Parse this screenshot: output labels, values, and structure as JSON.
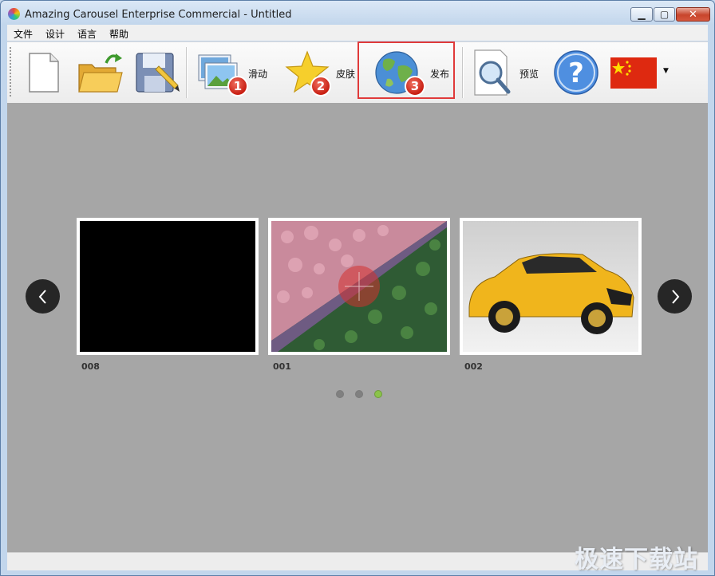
{
  "window": {
    "title": "Amazing Carousel Enterprise Commercial - Untitled"
  },
  "menu": [
    "文件",
    "设计",
    "语言",
    "帮助"
  ],
  "toolbar": {
    "slides_label": "滑动",
    "skin_label": "皮肤",
    "publish_label": "发布",
    "preview_label": "预览",
    "step_badges": [
      "1",
      "2",
      "3"
    ]
  },
  "carousel": {
    "slides": [
      {
        "caption": "008",
        "content": "black"
      },
      {
        "caption": "001",
        "content": "forest-aerial"
      },
      {
        "caption": "002",
        "content": "yellow-suv"
      }
    ],
    "page_count": 3,
    "active_page": 3
  },
  "colors": {
    "highlight_border": "#e03a3a",
    "active_dot": "#8bc34a",
    "stage_background": "#a6a6a6"
  },
  "watermark": "极速下载站"
}
